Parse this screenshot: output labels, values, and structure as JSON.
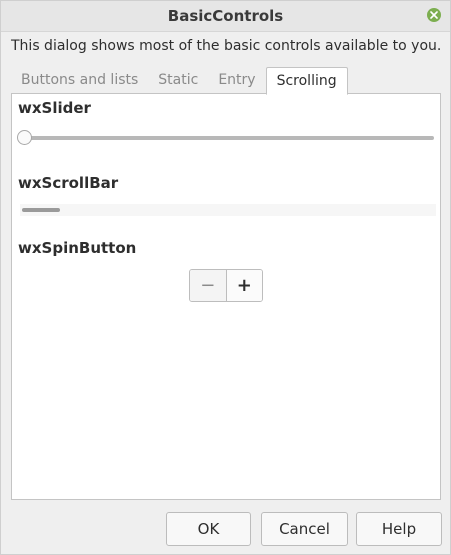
{
  "window": {
    "title": "BasicControls"
  },
  "intro_text": "This dialog shows most of the basic controls available to you.",
  "tabs": [
    {
      "label": "Buttons and lists",
      "active": false
    },
    {
      "label": "Static",
      "active": false
    },
    {
      "label": "Entry",
      "active": false
    },
    {
      "label": "Scrolling",
      "active": true
    }
  ],
  "scrolling_panel": {
    "slider_label": "wxSlider",
    "slider_value_fraction": 0.0,
    "scrollbar_label": "wxScrollBar",
    "scrollbar_position_fraction": 0.0,
    "spinbutton_label": "wxSpinButton",
    "spin_minus": "−",
    "spin_plus": "+"
  },
  "buttons": {
    "ok": "OK",
    "cancel": "Cancel",
    "help": "Help"
  },
  "colors": {
    "close_button": "#7cae4f",
    "panel_bg": "#ffffff",
    "window_bg": "#efefef"
  },
  "icons": {
    "close": "close-icon"
  }
}
